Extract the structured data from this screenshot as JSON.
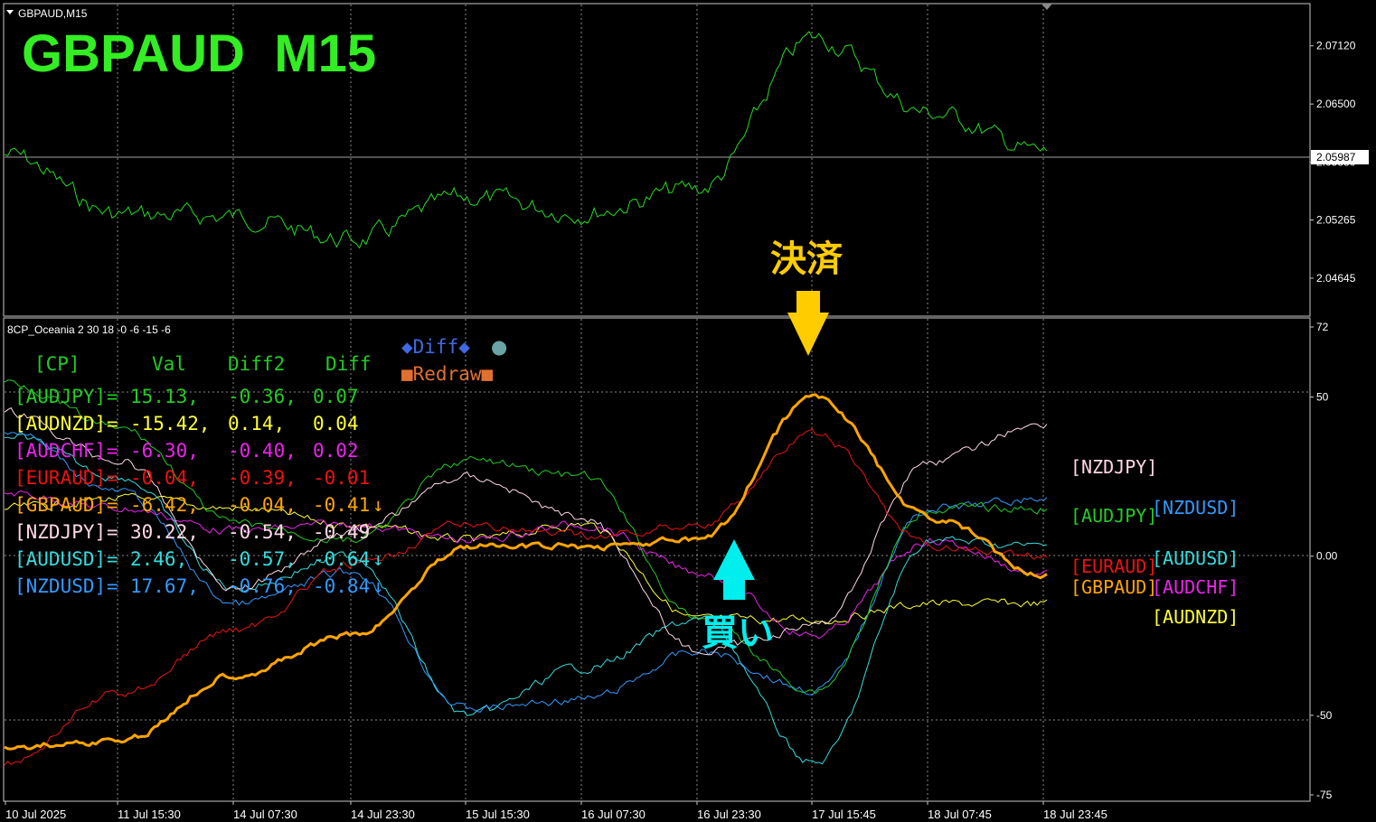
{
  "window": {
    "symbol_caption": "GBPAUD,M15",
    "big_title": "GBPAUD  M15",
    "big_title_color": "#33ee22"
  },
  "price_panel": {
    "current_price_label": "2.05987",
    "current_price": 2.05987,
    "y_ticks": [
      "2.07120",
      "2.06500",
      "2.05880",
      "2.05265",
      "2.04645"
    ],
    "ylim": [
      2.0425,
      2.0756
    ],
    "line_color": "#22dd22"
  },
  "indicator_panel": {
    "caption": "8CP_Oceania 2 30 18 -0 -6 -15 -6",
    "y_ticks": [
      "72",
      "50",
      "0.00",
      "-50",
      "-75"
    ],
    "ylim": [
      -75,
      72
    ],
    "buttons": {
      "diff": "◆Diff◆",
      "dot": "●",
      "redraw": "■Redraw■"
    },
    "table_header": [
      "[CP]",
      "Val",
      "Diff2",
      "Diff"
    ],
    "rows": [
      {
        "pair": "[AUDJPY]",
        "eq": "=",
        "val": "15.13,",
        "diff2": "-0.36,",
        "diff": "0.07",
        "arrow": "",
        "color": "#22cc22"
      },
      {
        "pair": "[AUDNZD]",
        "eq": "=",
        "val": "-15.42,",
        "diff2": "0.14,",
        "diff": "0.04",
        "arrow": "",
        "color": "#ffff33"
      },
      {
        "pair": "[AUDCHF]",
        "eq": "=",
        "val": "-6.30,",
        "diff2": "-0.40,",
        "diff": "0.02",
        "arrow": "",
        "color": "#ee22ee"
      },
      {
        "pair": "[EURAUD]",
        "eq": "=",
        "val": "-0.04,",
        "diff2": "-0.39,",
        "diff": "-0.01",
        "arrow": "",
        "color": "#ee1111"
      },
      {
        "pair": "[GBPAUD]",
        "eq": "=",
        "val": "-6.42,",
        "diff2": "-0.04,",
        "diff": "-0.41",
        "arrow": "↓",
        "color": "#ffa500"
      },
      {
        "pair": "[NZDJPY]",
        "eq": "=",
        "val": "30.22,",
        "diff2": "-0.54,",
        "diff": "-0.49",
        "arrow": "",
        "color": "#ffd8e4"
      },
      {
        "pair": "[AUDUSD]",
        "eq": "=",
        "val": "2.46,",
        "diff2": "-0.57,",
        "diff": "-0.64",
        "arrow": "↓",
        "color": "#33dddd"
      },
      {
        "pair": "[NZDUSD]",
        "eq": "=",
        "val": "17.67,",
        "diff2": "-0.76,",
        "diff": "-0.84",
        "arrow": "↓",
        "color": "#3399ff"
      }
    ],
    "right_labels": [
      {
        "text": "[NZDJPY]",
        "color": "#ffd8e4"
      },
      {
        "text": "[AUDJPY]",
        "color": "#22cc22"
      },
      {
        "text": "[NZDUSD]",
        "color": "#3399ff"
      },
      {
        "text": "[AUDUSD]",
        "color": "#33dddd"
      },
      {
        "text": "[EURAUD]",
        "color": "#ee1111"
      },
      {
        "text": "[GBPAUD]",
        "color": "#ffa500"
      },
      {
        "text": "[AUDCHF]",
        "color": "#ee22ee"
      },
      {
        "text": "[AUDNZD]",
        "color": "#ffff33"
      }
    ]
  },
  "annotations": {
    "exit_label": "決済",
    "exit_color": "#ffcc00",
    "buy_label": "買い",
    "buy_color": "#00eeee"
  },
  "x_ticks": [
    "10 Jul 2025",
    "11 Jul 15:30",
    "14 Jul 07:30",
    "14 Jul 23:30",
    "15 Jul 15:30",
    "16 Jul 07:30",
    "16 Jul 23:30",
    "17 Jul 15:45",
    "18 Jul 07:45",
    "18 Jul 23:45"
  ],
  "chart_data": [
    {
      "type": "line",
      "title": "GBPAUD  M15",
      "x": [
        "10 Jul 2025",
        "11 Jul 15:30",
        "14 Jul 07:30",
        "14 Jul 23:30",
        "15 Jul 15:30",
        "16 Jul 07:30",
        "16 Jul 23:30",
        "17 Jul 15:45",
        "18 Jul 07:45",
        "18 Jul 23:45"
      ],
      "series": [
        {
          "name": "GBPAUD",
          "values": [
            2.0596,
            2.0532,
            2.053,
            2.0505,
            2.055,
            2.0535,
            2.056,
            2.072,
            2.064,
            2.0598
          ]
        }
      ],
      "ylim": [
        2.0425,
        2.0756
      ],
      "grid": true
    },
    {
      "type": "line",
      "title": "8CP_Oceania 2 30 18 -0 -6 -15 -6",
      "x": [
        "10 Jul 2025",
        "11 Jul 15:30",
        "14 Jul 07:30",
        "14 Jul 23:30",
        "15 Jul 15:30",
        "16 Jul 07:30",
        "16 Jul 23:30",
        "17 Jul 15:45",
        "18 Jul 07:45",
        "18 Jul 23:45"
      ],
      "series": [
        {
          "name": "GBPAUD",
          "color": "#ffa500",
          "values": [
            -60,
            -58,
            -37,
            -25,
            3,
            3,
            5,
            50,
            12,
            -6
          ]
        },
        {
          "name": "EURAUD",
          "color": "#ee1111",
          "values": [
            -65,
            -43,
            -23,
            -3,
            10,
            6,
            10,
            38,
            3,
            0
          ]
        },
        {
          "name": "NZDJPY",
          "color": "#ffd8e4",
          "values": [
            45,
            30,
            -10,
            8,
            25,
            12,
            -30,
            -22,
            30,
            42
          ]
        },
        {
          "name": "AUDJPY",
          "color": "#22cc22",
          "values": [
            55,
            40,
            10,
            5,
            30,
            25,
            -20,
            -42,
            15,
            15
          ]
        },
        {
          "name": "NZDUSD",
          "color": "#3399ff",
          "values": [
            40,
            20,
            -15,
            -5,
            -48,
            -45,
            -30,
            -42,
            15,
            18
          ]
        },
        {
          "name": "AUDUSD",
          "color": "#33dddd",
          "values": [
            38,
            25,
            -10,
            0,
            -50,
            -35,
            -20,
            -65,
            5,
            3
          ]
        },
        {
          "name": "AUDCHF",
          "color": "#ee22ee",
          "values": [
            20,
            15,
            8,
            10,
            5,
            10,
            -5,
            -25,
            5,
            -6
          ]
        },
        {
          "name": "AUDNZD",
          "color": "#ffff33",
          "values": [
            15,
            18,
            15,
            10,
            5,
            10,
            -20,
            -20,
            -15,
            -15
          ]
        }
      ],
      "ylim": [
        -75,
        72
      ],
      "grid": true
    }
  ]
}
